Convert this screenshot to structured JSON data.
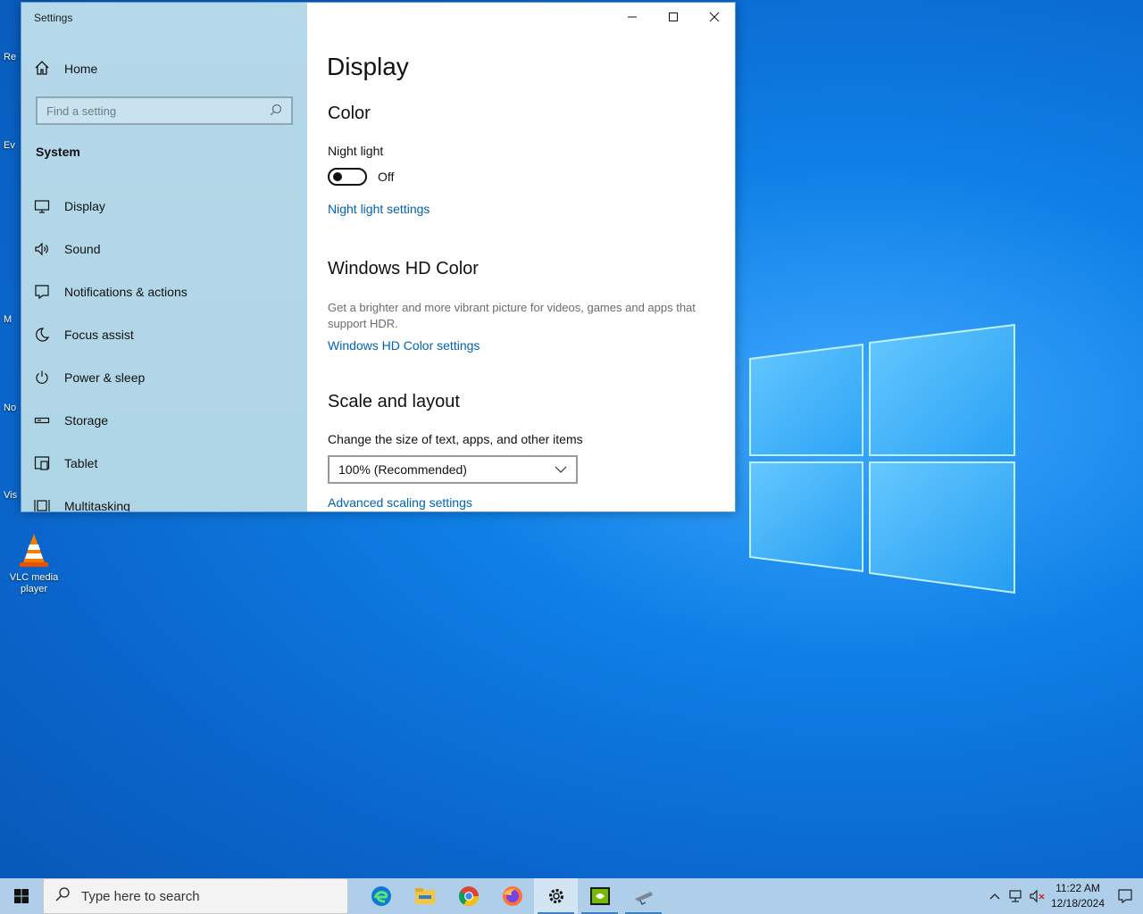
{
  "window": {
    "title": "Settings"
  },
  "sidebar": {
    "home_label": "Home",
    "search_placeholder": "Find a setting",
    "group_label": "System",
    "items": [
      {
        "label": "Display",
        "icon": "monitor-icon"
      },
      {
        "label": "Sound",
        "icon": "speaker-icon"
      },
      {
        "label": "Notifications & actions",
        "icon": "message-icon"
      },
      {
        "label": "Focus assist",
        "icon": "moon-icon"
      },
      {
        "label": "Power & sleep",
        "icon": "power-icon"
      },
      {
        "label": "Storage",
        "icon": "storage-icon"
      },
      {
        "label": "Tablet",
        "icon": "tablet-icon"
      },
      {
        "label": "Multitasking",
        "icon": "multitasking-icon"
      }
    ]
  },
  "main": {
    "page_title": "Display",
    "color_heading": "Color",
    "night_light_label": "Night light",
    "night_light_state": "Off",
    "night_light_link": "Night light settings",
    "hdr_heading": "Windows HD Color",
    "hdr_desc": "Get a brighter and more vibrant picture for videos, games and apps that support HDR.",
    "hdr_link": "Windows HD Color settings",
    "scale_heading": "Scale and layout",
    "scale_label": "Change the size of text, apps, and other items",
    "scale_value": "100% (Recommended)",
    "advanced_link": "Advanced scaling settings"
  },
  "desktop": {
    "vlc_label": "VLC media player",
    "partial_labels": [
      "Re",
      "Ev",
      "M",
      "No",
      "Vis"
    ]
  },
  "taskbar": {
    "search_placeholder": "Type here to search",
    "apps": [
      "edge-icon",
      "file-explorer-icon",
      "chrome-icon",
      "firefox-icon",
      "settings-icon",
      "nvidia-icon",
      "app-icon"
    ],
    "time": "11:22 AM",
    "date": "12/18/2024"
  },
  "colors": {
    "accent_link": "#0063b1",
    "sidebar_bg": "#b5d9ea",
    "desktop_bg": "#0e7fe6"
  }
}
